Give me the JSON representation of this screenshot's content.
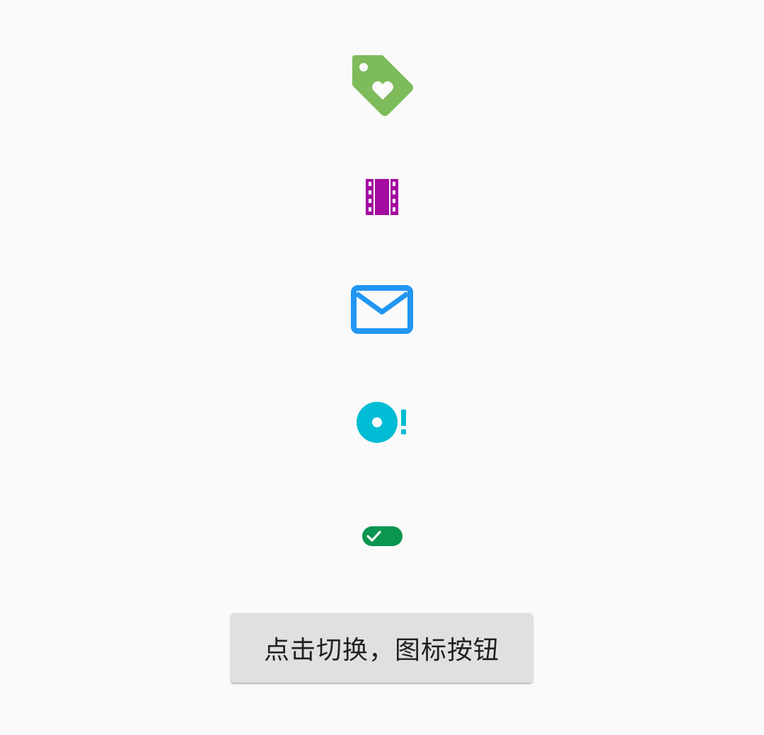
{
  "icons": [
    {
      "name": "tag-heart-icon",
      "color": "#7dbb5b"
    },
    {
      "name": "film-strip-icon",
      "color": "#a30aa0"
    },
    {
      "name": "mail-outline-icon",
      "color": "#2196f3"
    },
    {
      "name": "disc-alert-icon",
      "color": "#00bcd4"
    },
    {
      "name": "toggle-check-icon",
      "color": "#0a9551"
    }
  ],
  "button": {
    "label": "点击切换，图标按钮"
  }
}
